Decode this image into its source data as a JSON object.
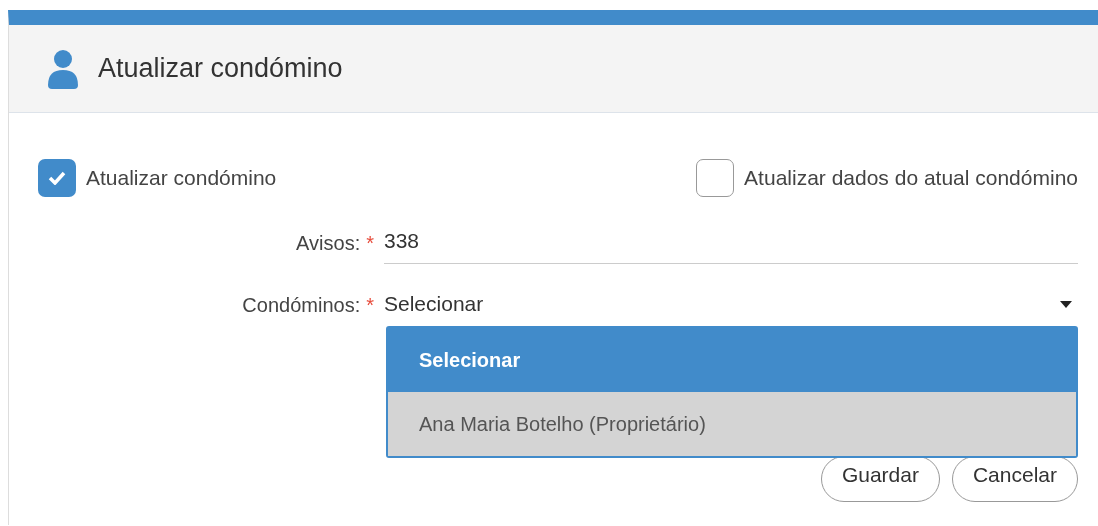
{
  "panel": {
    "title": "Atualizar condómino"
  },
  "options": [
    {
      "label": "Atualizar condómino",
      "checked": true
    },
    {
      "label": "Atualizar dados do atual condómino",
      "checked": false
    }
  ],
  "fields": [
    {
      "kind": "text",
      "label": "Avisos:",
      "required_mark": "*",
      "value": "338"
    },
    {
      "kind": "select",
      "label": "Condóminos:",
      "required_mark": "*",
      "value": "Selecionar",
      "expanded": true,
      "choices": [
        {
          "label": "Selecionar",
          "selected": true,
          "highlighted": false
        },
        {
          "label": "Ana Maria Botelho (Proprietário)",
          "selected": false,
          "highlighted": true
        }
      ]
    }
  ],
  "buttons": [
    "Guardar",
    "Cancelar"
  ]
}
